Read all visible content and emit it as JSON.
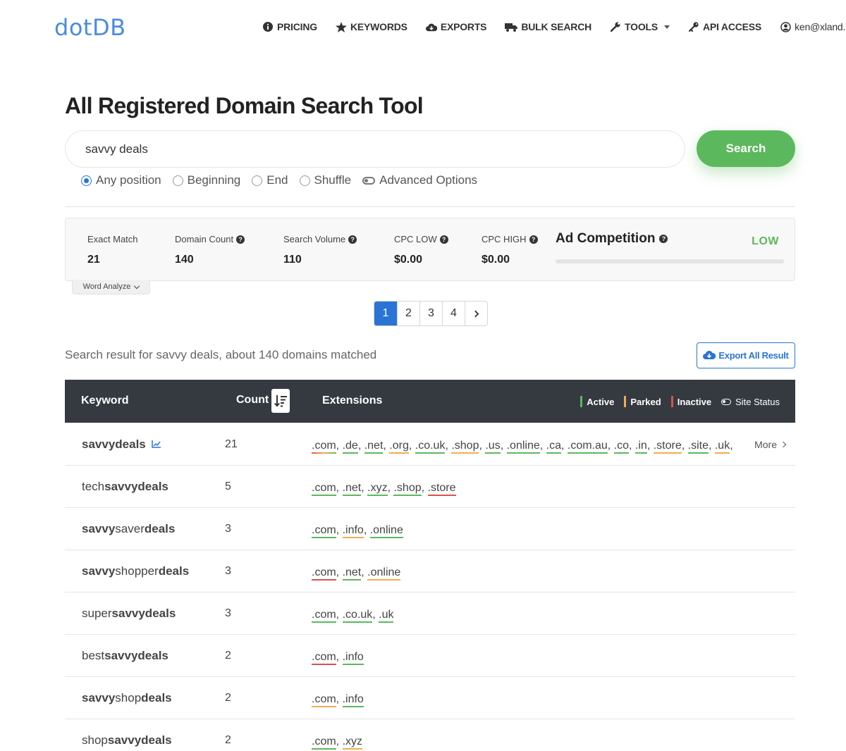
{
  "nav": {
    "logo": "dotDB",
    "items": [
      {
        "label": "PRICING",
        "icon": "info-circle-icon"
      },
      {
        "label": "KEYWORDS",
        "icon": "star-icon"
      },
      {
        "label": "EXPORTS",
        "icon": "cloud-download-icon"
      },
      {
        "label": "BULK SEARCH",
        "icon": "truck-icon"
      },
      {
        "label": "TOOLS",
        "icon": "wrench-icon"
      },
      {
        "label": "API ACCESS",
        "icon": "key-icon"
      },
      {
        "label": "ken@xland.com",
        "icon": "user-circle-icon"
      }
    ]
  },
  "page": {
    "title": "All Registered Domain Search Tool",
    "search_value": "savvy deals",
    "search_button": "Search",
    "options": [
      "Any position",
      "Beginning",
      "End",
      "Shuffle"
    ],
    "selected_option": "Any position",
    "advanced": "Advanced Options"
  },
  "stats": {
    "exact_match_label": "Exact Match",
    "exact_match": "21",
    "domain_count_label": "Domain Count",
    "domain_count": "140",
    "search_volume_label": "Search Volume",
    "search_volume": "110",
    "cpc_low_label": "CPC LOW",
    "cpc_low": "$0.00",
    "cpc_high_label": "CPC HIGH",
    "cpc_high": "$0.00",
    "ad_competition_label": "Ad Competition",
    "ad_competition_level": "LOW",
    "ad_competition_fraction": 0.0,
    "word_analyze": "Word Analyze"
  },
  "pagination": {
    "pages": [
      "1",
      "2",
      "3",
      "4"
    ],
    "current": "1"
  },
  "results": {
    "info": "Search result for savvy deals, about 140 domains matched",
    "export": "Export All Result"
  },
  "table": {
    "headers": {
      "keyword": "Keyword",
      "count": "Count",
      "extensions": "Extensions"
    },
    "legend": {
      "active": "Active",
      "parked": "Parked",
      "inactive": "Inactive",
      "site_status": "Site Status"
    },
    "more": "More",
    "colors": {
      "active": "#5cb85c",
      "parked": "#f0ad4e",
      "inactive": "#d9534f"
    },
    "rows": [
      {
        "parts": [
          {
            "t": "savvydeals",
            "b": true
          }
        ],
        "count": "21",
        "trend": true,
        "more": true,
        "exts": [
          [
            ".com",
            "mixed"
          ],
          [
            ".de",
            "active"
          ],
          [
            ".net",
            "active"
          ],
          [
            ".org",
            "parked"
          ],
          [
            ".co.uk",
            "active"
          ],
          [
            ".shop",
            "parked"
          ],
          [
            ".us",
            "active"
          ],
          [
            ".online",
            "active"
          ],
          [
            ".ca",
            "active"
          ],
          [
            ".com.au",
            "active"
          ],
          [
            ".co",
            "active"
          ],
          [
            ".in",
            "active"
          ],
          [
            ".store",
            "parked"
          ],
          [
            ".site",
            "active"
          ],
          [
            ".uk",
            "parked"
          ]
        ]
      },
      {
        "parts": [
          {
            "t": "tech",
            "b": false
          },
          {
            "t": "savvydeals",
            "b": true
          }
        ],
        "count": "5",
        "exts": [
          [
            ".com",
            "active"
          ],
          [
            ".net",
            "active"
          ],
          [
            ".xyz",
            "active"
          ],
          [
            ".shop",
            "active"
          ],
          [
            ".store",
            "inactive"
          ]
        ]
      },
      {
        "parts": [
          {
            "t": "savvy",
            "b": true
          },
          {
            "t": "saver",
            "b": false
          },
          {
            "t": "deals",
            "b": true
          }
        ],
        "count": "3",
        "exts": [
          [
            ".com",
            "active"
          ],
          [
            ".info",
            "parked"
          ],
          [
            ".online",
            "active"
          ]
        ]
      },
      {
        "parts": [
          {
            "t": "savvy",
            "b": true
          },
          {
            "t": "shopper",
            "b": false
          },
          {
            "t": "deals",
            "b": true
          }
        ],
        "count": "3",
        "exts": [
          [
            ".com",
            "inactive"
          ],
          [
            ".net",
            "active"
          ],
          [
            ".online",
            "parked"
          ]
        ]
      },
      {
        "parts": [
          {
            "t": "super",
            "b": false
          },
          {
            "t": "savvydeals",
            "b": true
          }
        ],
        "count": "3",
        "exts": [
          [
            ".com",
            "active"
          ],
          [
            ".co.uk",
            "active"
          ],
          [
            ".uk",
            "active"
          ]
        ]
      },
      {
        "parts": [
          {
            "t": "best",
            "b": false
          },
          {
            "t": "savvydeals",
            "b": true
          }
        ],
        "count": "2",
        "exts": [
          [
            ".com",
            "inactive"
          ],
          [
            ".info",
            "active"
          ]
        ]
      },
      {
        "parts": [
          {
            "t": "savvy",
            "b": true
          },
          {
            "t": "shop",
            "b": false
          },
          {
            "t": "deals",
            "b": true
          }
        ],
        "count": "2",
        "exts": [
          [
            ".com",
            "parked"
          ],
          [
            ".info",
            "active"
          ]
        ]
      },
      {
        "parts": [
          {
            "t": "shop",
            "b": false
          },
          {
            "t": "savvydeals",
            "b": true
          }
        ],
        "count": "2",
        "exts": [
          [
            ".com",
            "active"
          ],
          [
            ".xyz",
            "parked"
          ]
        ]
      }
    ]
  }
}
